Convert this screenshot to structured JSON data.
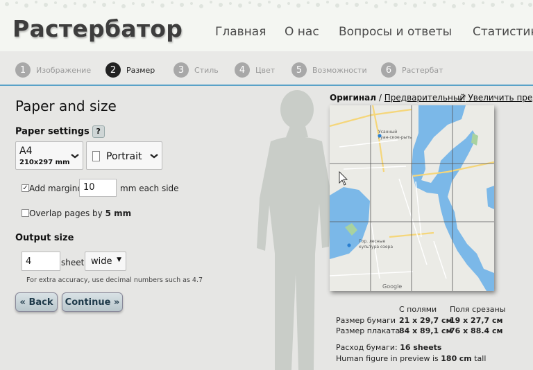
{
  "header": {
    "logo": "Растербатор",
    "nav": [
      "Главная",
      "О нас",
      "Вопросы и ответы",
      "Статистик"
    ]
  },
  "steps": [
    {
      "num": "1",
      "label": "Изображение",
      "active": false
    },
    {
      "num": "2",
      "label": "Размер",
      "active": true
    },
    {
      "num": "3",
      "label": "Стиль",
      "active": false
    },
    {
      "num": "4",
      "label": "Цвет",
      "active": false
    },
    {
      "num": "5",
      "label": "Возможности",
      "active": false
    },
    {
      "num": "6",
      "label": "Растербат",
      "active": false
    }
  ],
  "left": {
    "title": "Paper and size",
    "paper_settings": "Paper settings",
    "help": "?",
    "paper_size": "A4",
    "paper_dims": "210x297 mm",
    "orientation": "Portrait",
    "margin_checked": true,
    "margin_label": "Add marginof",
    "margin_value": "10",
    "margin_suffix": "mm each side",
    "overlap_checked": false,
    "overlap_label": "Overlap pages by",
    "overlap_value": "5 mm",
    "output_size": "Output size",
    "sheets_value": "4",
    "sheets_label": "sheets",
    "dimension": "wide",
    "accuracy_hint": "For extra accuracy, use decimal numbers such as 4.7",
    "back": "« Back",
    "continue": "Continue »"
  },
  "right": {
    "tab_original": "Оригинал",
    "tab_sep": "/",
    "tab_preview": "Предварительный",
    "enlarge": "Увеличить предва",
    "col_with_margins": "С полями",
    "col_trimmed": "Поля срезаны",
    "row_paper_size": "Размер бумаги",
    "paper_with": "21 x 29,7 см",
    "paper_trimmed": "19 x 27,7 см",
    "row_poster_size": "Размер плаката",
    "poster_with": "84 x 89,1 см",
    "poster_trimmed": "76 x 88.4 см",
    "paper_usage_label": "Расход бумаги:",
    "paper_usage_value": "16 sheets",
    "human_label": "Human figure in preview is",
    "human_value": "180",
    "human_unit": "cm",
    "human_suffix": "tall",
    "map_label_1": "Усанный",
    "map_label_2": "гуан-ское-рыть",
    "map_label_3": "Гор. лесные",
    "map_label_4": "культура озера",
    "map_google": "Google"
  },
  "colors": {
    "accent": "#5aa2c8",
    "water": "#7bb8e8",
    "button_text": "#1f3a4a"
  }
}
